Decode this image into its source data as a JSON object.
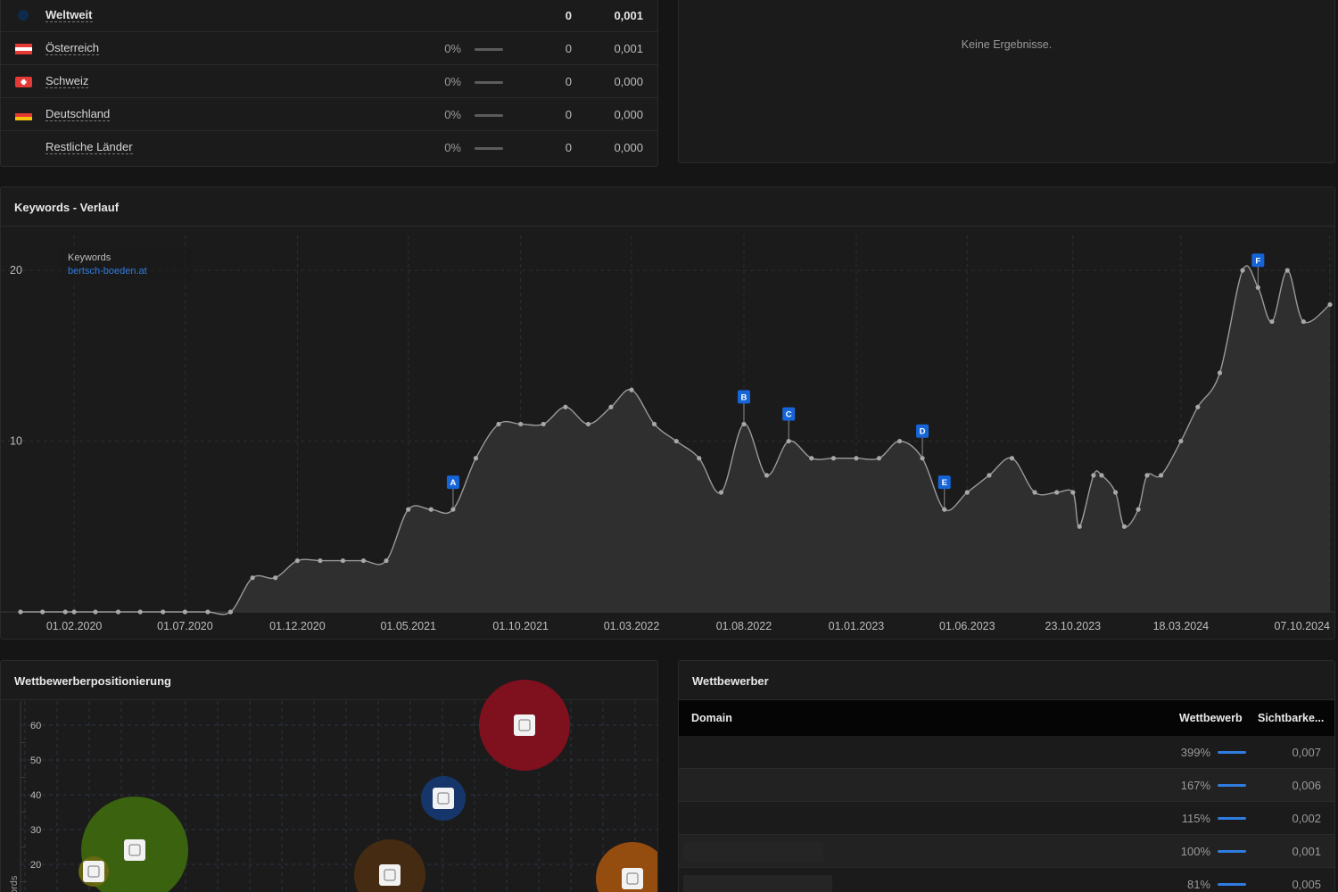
{
  "countries": [
    {
      "name": "Weltweit",
      "percent": "",
      "keywords": "0",
      "visibility": "0,001",
      "flag": "globe-icon",
      "bold": true
    },
    {
      "name": "Österreich",
      "percent": "0%",
      "keywords": "0",
      "visibility": "0,001",
      "flag": "flag-austria-icon"
    },
    {
      "name": "Schweiz",
      "percent": "0%",
      "keywords": "0",
      "visibility": "0,000",
      "flag": "flag-switzerland-icon"
    },
    {
      "name": "Deutschland",
      "percent": "0%",
      "keywords": "0",
      "visibility": "0,000",
      "flag": "flag-germany-icon"
    },
    {
      "name": "Restliche Länder",
      "percent": "0%",
      "keywords": "0",
      "visibility": "0,000",
      "flag": ""
    }
  ],
  "no_results": {
    "message": "Keine Ergebnisse."
  },
  "keywords_chart": {
    "title": "Keywords - Verlauf",
    "legend": {
      "label": "Keywords",
      "domain": "bertsch-boeden.at"
    },
    "colors": {
      "line": "#9a9a9a",
      "area": "#333333",
      "marker": "#1565d8",
      "legend_domain": "#2f7ce0"
    }
  },
  "chart_data": {
    "type": "area",
    "title": "Keywords - Verlauf",
    "xlabel": "",
    "ylabel": "",
    "ylim": [
      0,
      21
    ],
    "yticks": [
      10,
      20
    ],
    "xlim": [
      "2019-11-20",
      "2024-10-07"
    ],
    "xticks": [
      "01.02.2020",
      "01.07.2020",
      "01.12.2020",
      "01.05.2021",
      "01.10.2021",
      "01.03.2022",
      "01.08.2022",
      "01.01.2023",
      "01.06.2023",
      "23.10.2023",
      "18.03.2024",
      "07.10.2024"
    ],
    "xtick_dates": [
      "2020-02-01",
      "2020-07-01",
      "2020-12-01",
      "2021-05-01",
      "2021-10-01",
      "2022-03-01",
      "2022-08-01",
      "2023-01-01",
      "2023-06-01",
      "2023-10-23",
      "2024-03-18",
      "2024-10-07"
    ],
    "grid": true,
    "series": [
      {
        "name": "bertsch-boeden.at",
        "points": [
          [
            "2019-11-20",
            0
          ],
          [
            "2019-12-20",
            0
          ],
          [
            "2020-01-20",
            0
          ],
          [
            "2020-02-01",
            0
          ],
          [
            "2020-03-01",
            0
          ],
          [
            "2020-04-01",
            0
          ],
          [
            "2020-05-01",
            0
          ],
          [
            "2020-06-01",
            0
          ],
          [
            "2020-07-01",
            0
          ],
          [
            "2020-08-01",
            0
          ],
          [
            "2020-09-01",
            0
          ],
          [
            "2020-10-01",
            2
          ],
          [
            "2020-11-01",
            2
          ],
          [
            "2020-12-01",
            3
          ],
          [
            "2021-01-01",
            3
          ],
          [
            "2021-02-01",
            3
          ],
          [
            "2021-03-01",
            3
          ],
          [
            "2021-04-01",
            3
          ],
          [
            "2021-05-01",
            6
          ],
          [
            "2021-06-01",
            6
          ],
          [
            "2021-07-01",
            6
          ],
          [
            "2021-08-01",
            9
          ],
          [
            "2021-09-01",
            11
          ],
          [
            "2021-10-01",
            11
          ],
          [
            "2021-11-01",
            11
          ],
          [
            "2021-12-01",
            12
          ],
          [
            "2022-01-01",
            11
          ],
          [
            "2022-02-01",
            12
          ],
          [
            "2022-03-01",
            13
          ],
          [
            "2022-04-01",
            11
          ],
          [
            "2022-05-01",
            10
          ],
          [
            "2022-06-01",
            9
          ],
          [
            "2022-07-01",
            7
          ],
          [
            "2022-08-01",
            11
          ],
          [
            "2022-09-01",
            8
          ],
          [
            "2022-10-01",
            10
          ],
          [
            "2022-11-01",
            9
          ],
          [
            "2022-12-01",
            9
          ],
          [
            "2023-01-01",
            9
          ],
          [
            "2023-02-01",
            9
          ],
          [
            "2023-03-01",
            10
          ],
          [
            "2023-04-01",
            9
          ],
          [
            "2023-05-01",
            6
          ],
          [
            "2023-06-01",
            7
          ],
          [
            "2023-07-01",
            8
          ],
          [
            "2023-08-01",
            9
          ],
          [
            "2023-09-01",
            7
          ],
          [
            "2023-10-01",
            7
          ],
          [
            "2023-10-23",
            7
          ],
          [
            "2023-11-01",
            5
          ],
          [
            "2023-11-20",
            8
          ],
          [
            "2023-12-01",
            8
          ],
          [
            "2023-12-20",
            7
          ],
          [
            "2024-01-01",
            5
          ],
          [
            "2024-01-20",
            6
          ],
          [
            "2024-02-01",
            8
          ],
          [
            "2024-02-20",
            8
          ],
          [
            "2024-03-18",
            10
          ],
          [
            "2024-04-10",
            12
          ],
          [
            "2024-05-10",
            14
          ],
          [
            "2024-06-10",
            20
          ],
          [
            "2024-07-01",
            19
          ],
          [
            "2024-07-20",
            17
          ],
          [
            "2024-08-10",
            20
          ],
          [
            "2024-09-01",
            17
          ],
          [
            "2024-10-07",
            18
          ]
        ]
      }
    ],
    "annotations": [
      {
        "label": "A",
        "x": "2021-07-01",
        "y": 6
      },
      {
        "label": "B",
        "x": "2022-08-01",
        "y": 11
      },
      {
        "label": "C",
        "x": "2022-10-01",
        "y": 10
      },
      {
        "label": "D",
        "x": "2023-04-01",
        "y": 9
      },
      {
        "label": "E",
        "x": "2023-05-01",
        "y": 6
      },
      {
        "label": "F",
        "x": "2024-07-01",
        "y": 19
      }
    ]
  },
  "positioning": {
    "title": "Wettbewerberpositionierung",
    "yticks": [
      "60",
      "50",
      "40",
      "30",
      "20"
    ],
    "ylabel": "ords",
    "bubbles": [
      {
        "name": "red",
        "color": "#8b0f1f",
        "value_y": 60
      },
      {
        "name": "blue",
        "color": "#163a74",
        "value_y": 40
      },
      {
        "name": "green",
        "color": "#3e6a0e",
        "value_y": 25
      },
      {
        "name": "brown",
        "color": "#4a2d12",
        "value_y": 20
      },
      {
        "name": "orange",
        "color": "#a3520e",
        "value_y": 18
      },
      {
        "name": "small-olive",
        "color": "#6e6a12",
        "value_y": 20
      }
    ]
  },
  "competitors": {
    "title": "Wettbewerber",
    "headers": {
      "domain": "Domain",
      "competition": "Wettbewerb",
      "visibility": "Sichtbarke..."
    },
    "rows": [
      {
        "percent": "399%",
        "visibility": "0,007"
      },
      {
        "percent": "167%",
        "visibility": "0,006"
      },
      {
        "percent": "115%",
        "visibility": "0,002"
      },
      {
        "percent": "100%",
        "visibility": "0,001"
      },
      {
        "percent": "81%",
        "visibility": "0,005"
      }
    ]
  }
}
